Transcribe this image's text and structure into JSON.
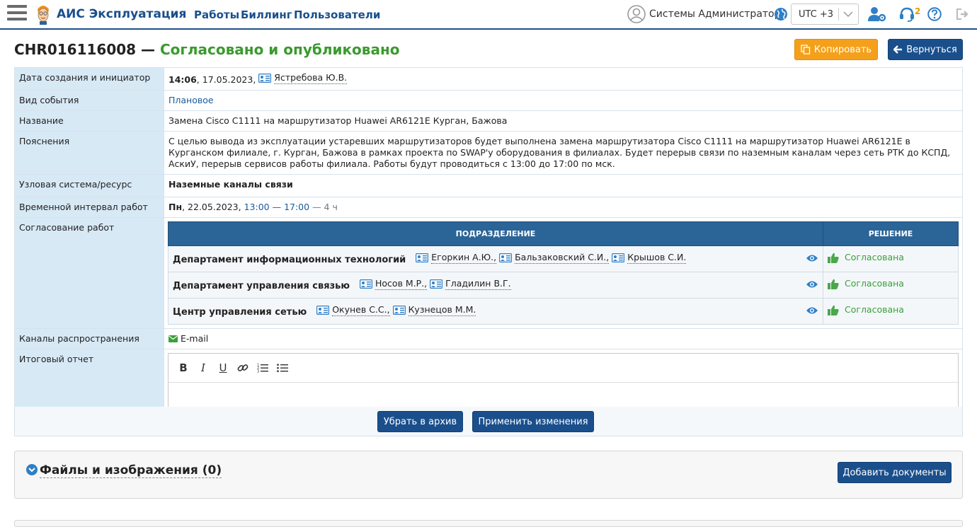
{
  "app": {
    "title": "АИС Эксплуатация"
  },
  "nav": {
    "items": [
      "Работы",
      "Биллинг",
      "Пользователи"
    ]
  },
  "user": {
    "name": "Системы Администратор"
  },
  "timezone": {
    "value": "UTC +3"
  },
  "notifications": {
    "count": "2"
  },
  "page": {
    "id": "CHR016116008 —",
    "status": "Согласовано и опубликовано",
    "copy_label": "Копировать",
    "back_label": "Вернуться"
  },
  "details": {
    "created": {
      "label": "Дата создания и инициатор",
      "time": "14:06",
      "date": ", 17.05.2023,",
      "initiator": "Ястребова Ю.В."
    },
    "event_type": {
      "label": "Вид события",
      "value": "Плановое"
    },
    "name": {
      "label": "Название",
      "value": "Замена Cisco C1111 на маршрутизатор Huawei AR6121E Курган, Бажова"
    },
    "explanation": {
      "label": "Пояснения",
      "value": "С целью вывода из эксплуатации устаревших маршрутизаторов будет выполнена замена маршрутизатора Cisco C1111 на маршрутизатор Huawei AR6121E в Курганском филиале, г. Курган, Бажова в рамках проекта по SWAP'у оборудования в филиалах. Будет перерыв связи по наземным каналам через сеть РТК до КСПД, АскиУ, перерыв сервисов работы филиала. Работы будут проводиться с 13:00 до 17:00 по мск."
    },
    "system": {
      "label": "Узловая система/ресурс",
      "value": "Наземные каналы связи"
    },
    "interval": {
      "label": "Временной интервал работ",
      "day": "Пн",
      "date": ", 22.05.2023,",
      "range": "13:00 — 17:00",
      "duration": "— 4 ч"
    },
    "approval": {
      "label": "Согласование работ",
      "col_dept": "ПОДРАЗДЕЛЕНИЕ",
      "col_decision": "РЕШЕНИЕ",
      "rows": [
        {
          "dept": "Департамент информационных технологий",
          "people": [
            "Егоркин А.Ю.,",
            "Бальзаковский С.И.,",
            "Крышов С.И."
          ],
          "decision": "Согласована"
        },
        {
          "dept": "Департамент управления связью",
          "people": [
            "Носов М.Р.,",
            "Гладилин В.Г."
          ],
          "decision": "Согласована"
        },
        {
          "dept": "Центр управления сетью",
          "people": [
            "Окунев С.С.,",
            "Кузнецов М.М."
          ],
          "decision": "Согласована"
        }
      ]
    },
    "channels": {
      "label": "Каналы распространения",
      "value": "E-mail"
    },
    "report": {
      "label": "Итоговый отчет"
    }
  },
  "editor_toolbar": {
    "bold": "B",
    "italic": "I",
    "underline": "U"
  },
  "actions": {
    "archive_label": "Убрать в архив",
    "apply_label": "Применить изменения"
  },
  "files": {
    "title": "Файлы и изображения (0)",
    "add_label": "Добавить документы"
  },
  "colors": {
    "accent": "#1a4f8c",
    "status_green": "#3a9a2e",
    "orange": "#f5a01a",
    "label_bg": "#d8e9f6",
    "header_blue": "#2b6496"
  }
}
